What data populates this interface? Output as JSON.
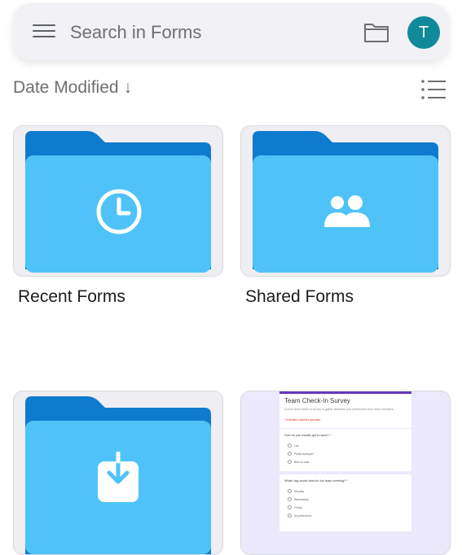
{
  "search": {
    "placeholder": "Search in Forms"
  },
  "header": {
    "avatar_letter": "T",
    "avatar_color": "#108a9a"
  },
  "sort": {
    "label": "Date Modified",
    "arrow": "↓"
  },
  "folders": [
    {
      "label": "Recent Forms",
      "icon": "clock-icon"
    },
    {
      "label": "Shared Forms",
      "icon": "people-icon"
    },
    {
      "label": "",
      "icon": "download-icon"
    }
  ],
  "form_preview": {
    "title": "Team Check-In Survey",
    "description": "A short team check-in survey to gather feedback and preferences from team members.",
    "required_note": "* Indicates required question",
    "questions": [
      {
        "text": "How do you usually get to work? *",
        "options": [
          "Car",
          "Public transport",
          "Bike or walk"
        ]
      },
      {
        "text": "Which day works best for the team meeting? *",
        "options": [
          "Monday",
          "Wednesday",
          "Friday",
          "No preference"
        ]
      }
    ]
  },
  "colors": {
    "folder_back": "#0f7bcf",
    "folder_front": "#4fc3f7",
    "accent": "#673ab7"
  }
}
